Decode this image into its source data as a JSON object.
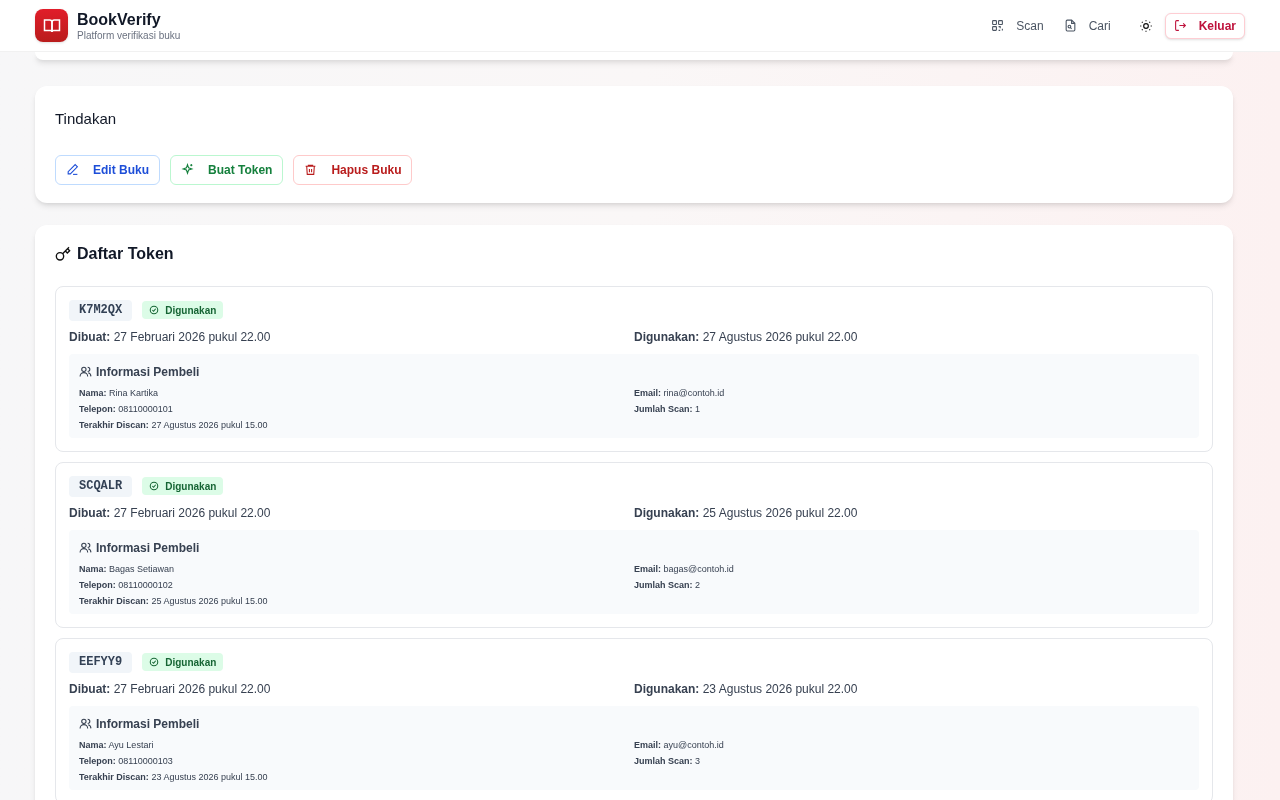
{
  "header": {
    "app_name": "BookVerify",
    "tagline": "Platform verifikasi buku",
    "nav": [
      {
        "kind": "scan",
        "label": "Scan"
      },
      {
        "kind": "search",
        "label": "Cari"
      }
    ],
    "logout": "Keluar"
  },
  "actions": {
    "title": "Tindakan",
    "buttons": [
      {
        "kind": "edit",
        "label": "Edit Buku"
      },
      {
        "kind": "token",
        "label": "Buat Token"
      },
      {
        "kind": "delete",
        "label": "Hapus Buku"
      }
    ]
  },
  "tokens": {
    "title": "Daftar Token",
    "items": [
      {
        "code": "K7M2QX",
        "status": "Digunakan",
        "created": "**Dibuat:** 27 Februari 2026 pukul 22.00",
        "used": "**Digunakan:** 27 Agustus 2026 pukul 22.00",
        "buyer_title": "Informasi Pembeli",
        "left": [
          "**Nama:** Rina Kartika",
          "**Telepon:** 08110000101",
          "**Terakhir Discan:** 27 Agustus 2026 pukul 15.00"
        ],
        "right": [
          "**Email:** rina@contoh.id",
          "**Jumlah Scan:** 1"
        ]
      },
      {
        "code": "SCQALR",
        "status": "Digunakan",
        "created": "**Dibuat:** 27 Februari 2026 pukul 22.00",
        "used": "**Digunakan:** 25 Agustus 2026 pukul 22.00",
        "buyer_title": "Informasi Pembeli",
        "left": [
          "**Nama:** Bagas Setiawan",
          "**Telepon:** 08110000102",
          "**Terakhir Discan:** 25 Agustus 2026 pukul 15.00"
        ],
        "right": [
          "**Email:** bagas@contoh.id",
          "**Jumlah Scan:** 2"
        ]
      },
      {
        "code": "EEFYY9",
        "status": "Digunakan",
        "created": "**Dibuat:** 27 Februari 2026 pukul 22.00",
        "used": "**Digunakan:** 23 Agustus 2026 pukul 22.00",
        "buyer_title": "Informasi Pembeli",
        "left": [
          "**Nama:** Ayu Lestari",
          "**Telepon:** 08110000103",
          "**Terakhir Discan:** 23 Agustus 2026 pukul 15.00"
        ],
        "right": [
          "**Email:** ayu@contoh.id",
          "**Jumlah Scan:** 3"
        ]
      }
    ]
  }
}
